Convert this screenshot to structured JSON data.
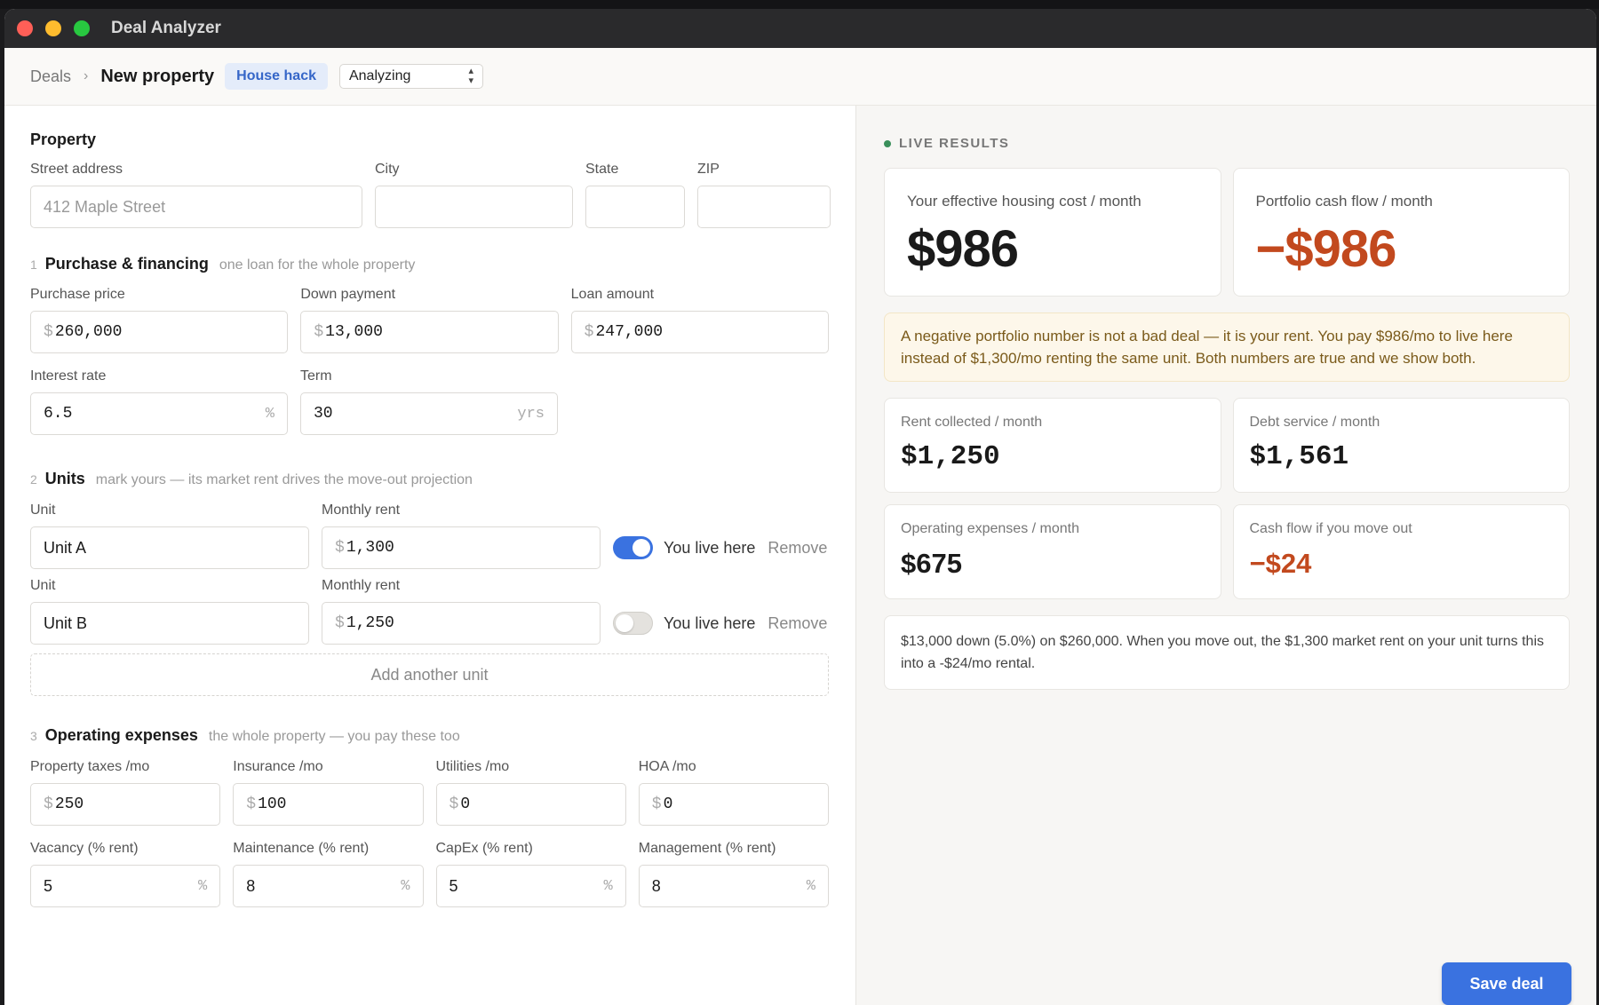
{
  "window": {
    "title": "Deal Analyzer"
  },
  "toolbar": {
    "breadcrumb_root": "Deals",
    "breadcrumb_sep": "›",
    "page_title": "New property",
    "badge": "House hack",
    "status": {
      "selected": "Analyzing"
    }
  },
  "property": {
    "title": "Property",
    "street_label": "Street address",
    "street_placeholder": "412 Maple Street",
    "city_label": "City",
    "city_value": "",
    "state_label": "State",
    "state_value": "",
    "zip_label": "ZIP",
    "zip_value": ""
  },
  "purchase": {
    "num": "1",
    "title": "Purchase & financing",
    "subtitle": "one loan for the whole property",
    "price_label": "Purchase price",
    "price_value": "260,000",
    "down_label": "Down payment",
    "down_value": "13,000",
    "loan_label": "Loan amount",
    "loan_value": "247,000",
    "rate_label": "Interest rate",
    "rate_value": "6.5",
    "rate_suffix": "%",
    "term_label": "Term",
    "term_value": "30",
    "term_suffix": "yrs",
    "currency": "$"
  },
  "units": {
    "num": "2",
    "title": "Units",
    "subtitle": "mark yours — its market rent drives the move-out projection",
    "unit_label": "Unit",
    "rent_label": "Monthly rent",
    "live_label": "You live here",
    "remove_label": "Remove",
    "add_label": "Add another unit",
    "items": [
      {
        "name": "Unit A",
        "rent": "1,300",
        "live_here": true
      },
      {
        "name": "Unit B",
        "rent": "1,250",
        "live_here": false
      }
    ]
  },
  "opex": {
    "num": "3",
    "title": "Operating expenses",
    "subtitle": "the whole property — you pay these too",
    "taxes_label": "Property taxes /mo",
    "taxes_value": "250",
    "insurance_label": "Insurance /mo",
    "insurance_value": "100",
    "utilities_label": "Utilities /mo",
    "utilities_value": "0",
    "hoa_label": "HOA /mo",
    "hoa_value": "0",
    "vacancy_label": "Vacancy (% rent)",
    "vacancy_value": "5",
    "maintenance_label": "Maintenance (% rent)",
    "maintenance_value": "8",
    "capex_label": "CapEx (% rent)",
    "capex_value": "5",
    "management_label": "Management (% rent)",
    "management_value": "8",
    "pct": "%"
  },
  "results": {
    "title": "LIVE RESULTS",
    "housing_label": "Your effective housing cost / month",
    "housing_value": "$986",
    "portfolio_label": "Portfolio cash flow / month",
    "portfolio_value": "−$986",
    "note": "A negative portfolio number is not a bad deal — it is your rent. You pay $986/mo to live here instead of $1,300/mo renting the same unit. Both numbers are true and we show both.",
    "rent_label": "Rent collected / month",
    "rent_value": "$1,250",
    "debt_label": "Debt service / month",
    "debt_value": "$1,561",
    "opex_label": "Operating expenses / month",
    "opex_value": "$675",
    "moveout_label": "Cash flow if you move out",
    "moveout_value": "−$24",
    "summary": "$13,000 down (5.0%) on $260,000. When you move out, the $1,300 market rent on your unit turns this into a -$24/mo rental.",
    "save_label": "Save deal"
  },
  "colors": {
    "accent": "#3a72e0",
    "negative": "#c2491e",
    "note_bg": "#fdf7ea"
  }
}
